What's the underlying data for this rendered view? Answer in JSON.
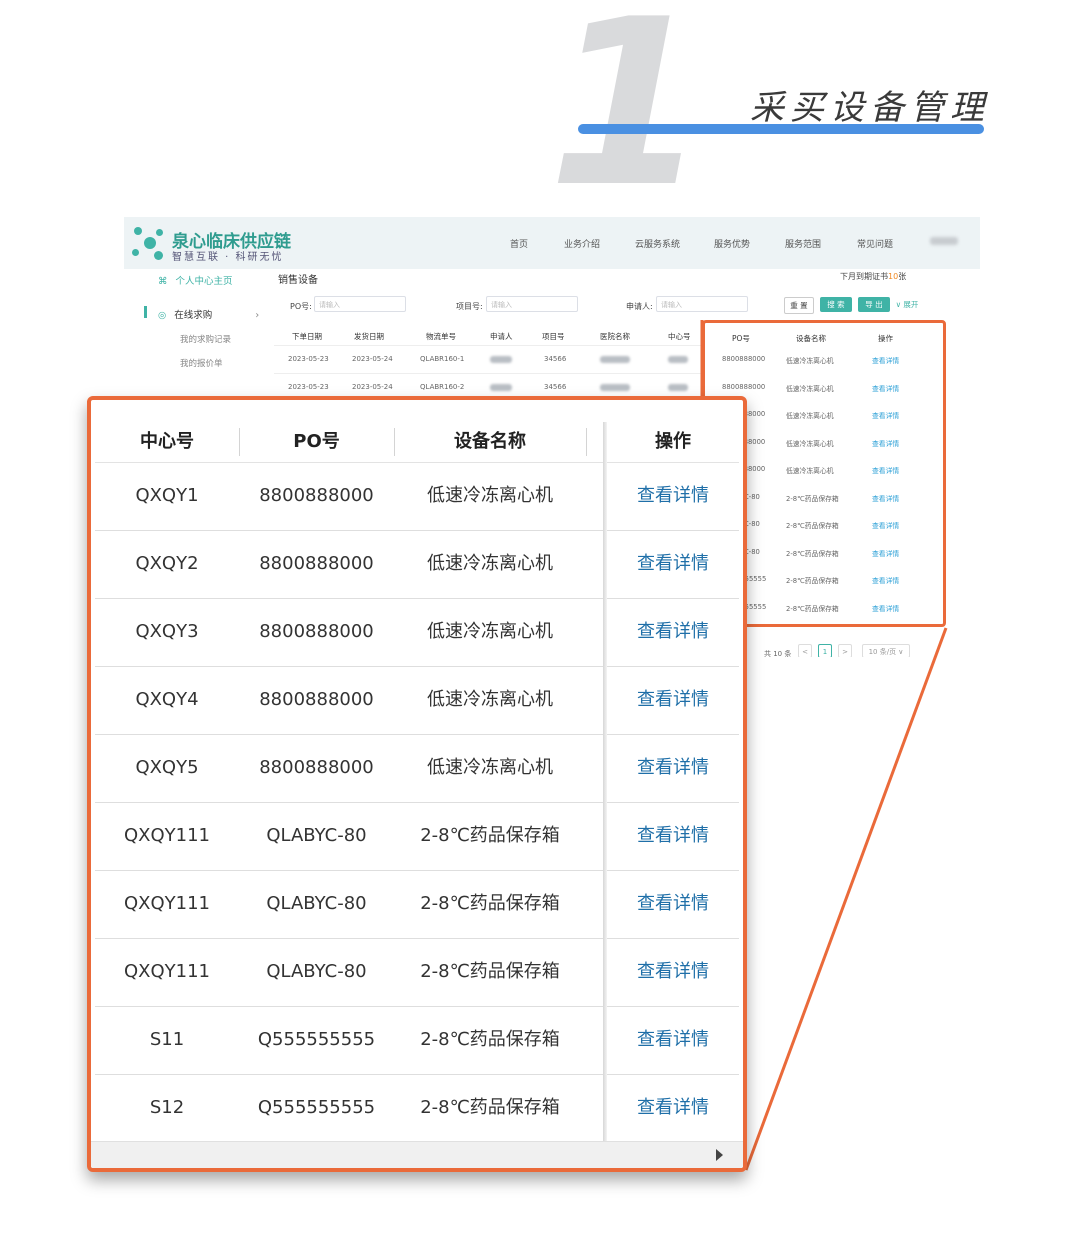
{
  "header": {
    "big_number": "1",
    "section_title": "采买设备管理",
    "accent_color": "#4a90e2"
  },
  "site": {
    "name": "泉心临床供应链",
    "slogan": "智慧互联 · 科研无忧",
    "nav": [
      "首页",
      "业务介绍",
      "云服务系统",
      "服务优势",
      "服务范围",
      "常见问题"
    ]
  },
  "sidebar": {
    "home": "个人中心主页",
    "online_purchase": "在线求购",
    "sub_items": [
      "我的求购记录",
      "我的报价单"
    ]
  },
  "main": {
    "page_title": "销售设备",
    "expiry_note_prefix": "下月到期证书",
    "expiry_count": "10",
    "expiry_note_suffix": "张",
    "filters": [
      {
        "label": "PO号:",
        "placeholder": "请输入"
      },
      {
        "label": "项目号:",
        "placeholder": "请输入"
      },
      {
        "label": "申请人:",
        "placeholder": "请输入"
      }
    ],
    "buttons": {
      "reset": "重 置",
      "search": "搜 索",
      "export": "导 出",
      "expand": "∨ 展开"
    },
    "columns": [
      "下单日期",
      "发货日期",
      "物流单号",
      "申请人",
      "项目号",
      "医院名称",
      "中心号"
    ],
    "rows": [
      [
        "2023-05-23",
        "2023-05-24",
        "QLABR160-1",
        "",
        "34566",
        "",
        ""
      ],
      [
        "2023-05-23",
        "2023-05-24",
        "QLABR160-2",
        "",
        "34566",
        "",
        ""
      ]
    ],
    "right_columns": [
      "PO号",
      "设备名称",
      "操作"
    ],
    "right_rows": [
      [
        "8800888000",
        "低速冷冻离心机",
        "查看详情"
      ],
      [
        "8800888000",
        "低速冷冻离心机",
        "查看详情"
      ],
      [
        "8800888000",
        "低速冷冻离心机",
        "查看详情"
      ],
      [
        "8800888000",
        "低速冷冻离心机",
        "查看详情"
      ],
      [
        "8800888000",
        "低速冷冻离心机",
        "查看详情"
      ],
      [
        "QLABYC-80",
        "2-8℃药品保存箱",
        "查看详情"
      ],
      [
        "QLABYC-80",
        "2-8℃药品保存箱",
        "查看详情"
      ],
      [
        "QLABYC-80",
        "2-8℃药品保存箱",
        "查看详情"
      ],
      [
        "Q555555555",
        "2-8℃药品保存箱",
        "查看详情"
      ],
      [
        "Q555555555",
        "2-8℃药品保存箱",
        "查看详情"
      ]
    ],
    "pagination": {
      "total": "共 10 条",
      "prev": "<",
      "page": "1",
      "next": ">",
      "page_size": "10 条/页 ∨"
    }
  },
  "zoom": {
    "columns": [
      "中心号",
      "PO号",
      "设备名称",
      "操作"
    ],
    "rows": [
      [
        "QXQY1",
        "8800888000",
        "低速冷冻离心机",
        "查看详情"
      ],
      [
        "QXQY2",
        "8800888000",
        "低速冷冻离心机",
        "查看详情"
      ],
      [
        "QXQY3",
        "8800888000",
        "低速冷冻离心机",
        "查看详情"
      ],
      [
        "QXQY4",
        "8800888000",
        "低速冷冻离心机",
        "查看详情"
      ],
      [
        "QXQY5",
        "8800888000",
        "低速冷冻离心机",
        "查看详情"
      ],
      [
        "QXQY111",
        "QLABYC-80",
        "2-8℃药品保存箱",
        "查看详情"
      ],
      [
        "QXQY111",
        "QLABYC-80",
        "2-8℃药品保存箱",
        "查看详情"
      ],
      [
        "QXQY111",
        "QLABYC-80",
        "2-8℃药品保存箱",
        "查看详情"
      ],
      [
        "S11",
        "Q555555555",
        "2-8℃药品保存箱",
        "查看详情"
      ],
      [
        "S12",
        "Q555555555",
        "2-8℃药品保存箱",
        "查看详情"
      ]
    ]
  },
  "colors": {
    "highlight_frame": "#ea6a3a",
    "brand": "#3fb3a6",
    "link": "#1f6fa8"
  }
}
